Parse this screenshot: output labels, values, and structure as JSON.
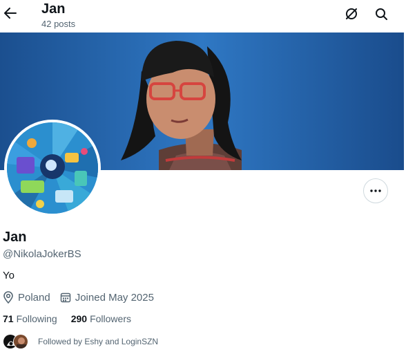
{
  "header": {
    "title": "Jan",
    "post_count": "42 posts"
  },
  "icons": {
    "back": "arrow-left-icon",
    "grok": "grok-icon",
    "search": "search-icon",
    "more": "more-dots-icon",
    "location": "location-pin-icon",
    "calendar": "calendar-icon"
  },
  "profile": {
    "name": "Jan",
    "handle": "@NikolaJokerBS",
    "bio": "Yo",
    "location": "Poland",
    "joined": "Joined May 2025"
  },
  "stats": {
    "following_count": "71",
    "following_label": "Following",
    "followers_count": "290",
    "followers_label": "Followers"
  },
  "followed_by": {
    "text": "Followed by Eshy and LoginSZN"
  },
  "colors": {
    "text_primary": "#0f1419",
    "text_secondary": "#536471",
    "border": "#cfd9de",
    "banner_background": "#1f5fa8"
  }
}
